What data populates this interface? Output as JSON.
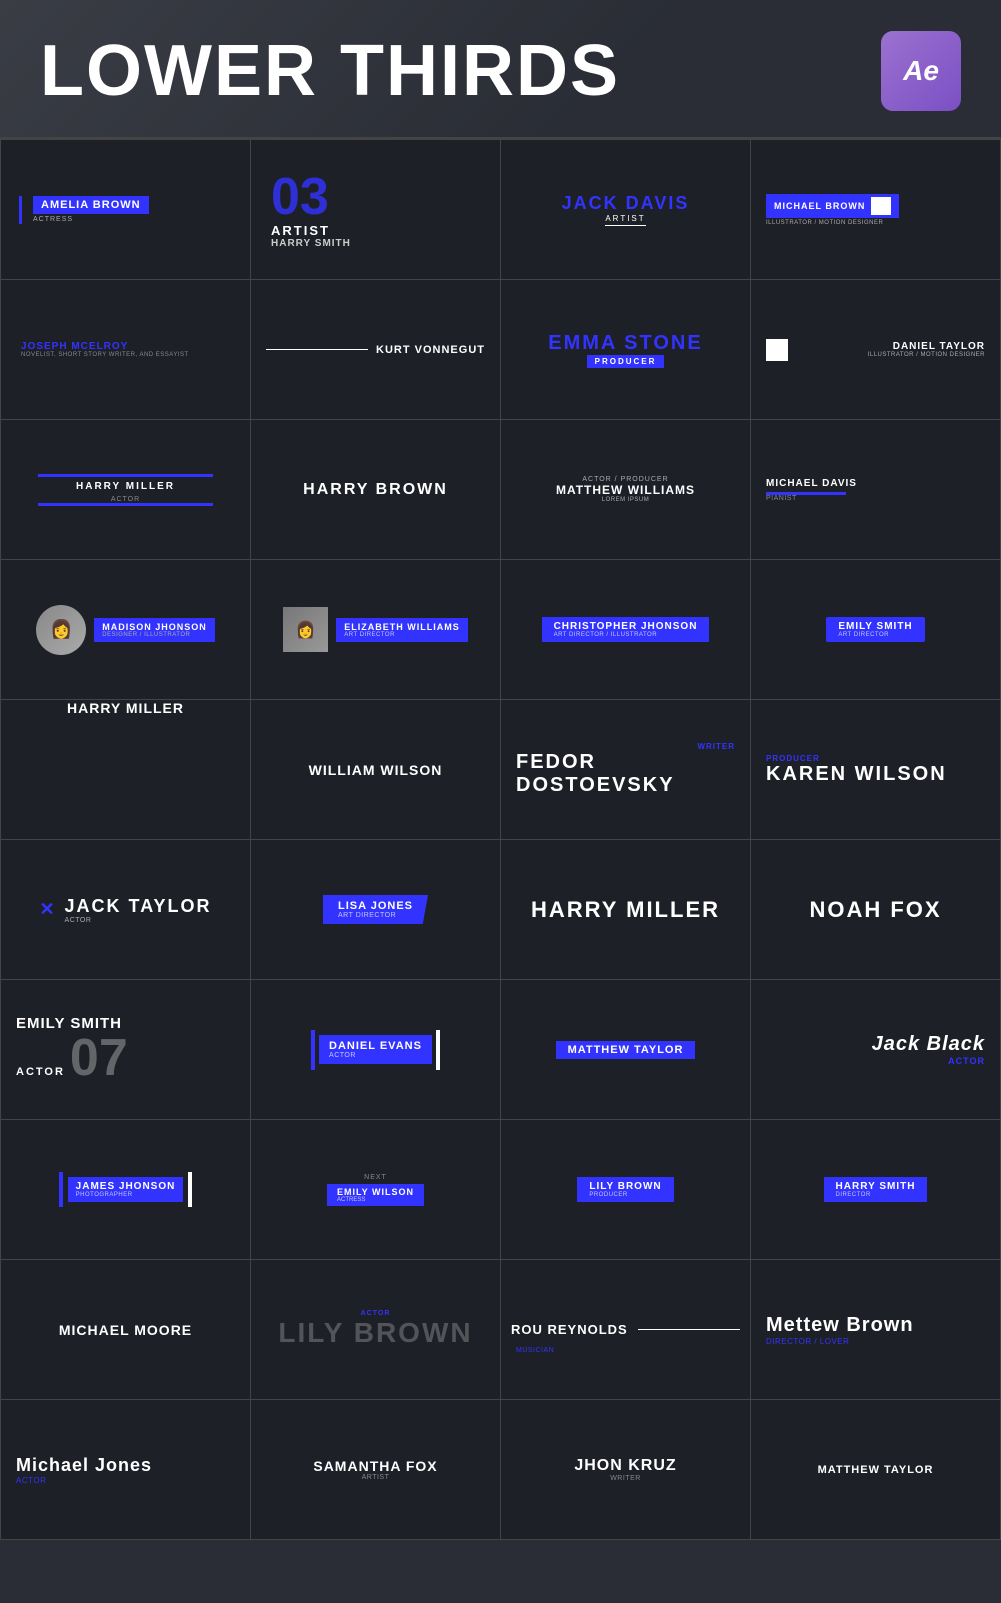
{
  "header": {
    "title": "LOWER THIRDS",
    "ae_label": "Ae"
  },
  "grid": {
    "rows": [
      [
        {
          "name": "AMELIA BROWN",
          "role": "ACTRESS",
          "style": "blue-bar-left"
        },
        {
          "number": "03",
          "title": "ARTIST",
          "subtitle": "HARRY SMITH",
          "style": "number-title"
        },
        {
          "name": "JACK DAVIS",
          "role": "ARTIST",
          "style": "centered-blue-underline"
        },
        {
          "name": "MICHAEL BROWN",
          "role": "ILLUSTRATOR / MOTION DESIGNER",
          "style": "blue-bar-white-square"
        }
      ],
      [
        {
          "name": "JOSEPH MCELROY",
          "role": "NOVELIST, SHORT STORY WRITER, AND ESSAYIST",
          "style": "blue-text-small"
        },
        {
          "name": "KURT VONNEGUT",
          "role": "",
          "style": "line-left-name"
        },
        {
          "name": "EMMA STONE",
          "role": "PRODUCER",
          "style": "big-blue-name-blue-badge"
        },
        {
          "name": "DANIEL TAYLOR",
          "role": "ILLUSTRATOR / MOTION DESIGNER",
          "style": "white-sq-left-name-right"
        }
      ],
      [
        {
          "name": "HARRY MILLER",
          "role": "ACTOR",
          "style": "bar-above-below"
        },
        {
          "name": "HARRY BROWN",
          "role": "",
          "style": "plain-center"
        },
        {
          "name": "MATTHEW WILLIAMS",
          "role": "ACTOR / PRODUCER",
          "role2": "LOREM IPSUM",
          "style": "role-above-name"
        },
        {
          "name": "MICHAEL DAVIS",
          "role": "PIANIST",
          "style": "name-left-blue-bar"
        }
      ],
      [
        {
          "name": "MADISON JHONSON",
          "role": "DESIGNER / ILLUSTRATOR",
          "style": "avatar-circle-blue",
          "avatar": "👩"
        },
        {
          "name": "ELIZABETH WILLIAMS",
          "role": "ART DIRECTOR",
          "style": "avatar-sq-blue",
          "avatar": "👩"
        },
        {
          "name": "CHRISTOPHER JHONSON",
          "role": "ART DIRECTOR / ILLUSTRATOR",
          "style": "full-blue-bar"
        },
        {
          "name": "EMILY SMITH",
          "role": "ART DIRECTOR",
          "style": "full-blue-bar-rounded"
        }
      ],
      [
        {
          "name": "HARRY MILLER",
          "role": "",
          "style": "plain-left"
        },
        {
          "name": "WILLIAM WILSON",
          "role": "",
          "style": "plain-center"
        },
        {
          "name": "FEDOR DOSTOEVSKY",
          "role": "WRITER",
          "style": "role-above-big-right"
        },
        {
          "name": "KAREN WILSON",
          "role": "PRODUCER",
          "style": "role-above-big-left"
        }
      ],
      [
        {
          "name": "JACK TAYLOR",
          "role": "ACTOR",
          "style": "x-icon-name"
        },
        {
          "name": "LISA JONES",
          "role": "ART DIRECTOR",
          "style": "parallelogram-blue"
        },
        {
          "name": "HARRY MILLER",
          "role": "",
          "style": "big-plain-center"
        },
        {
          "name": "NOAH FOX",
          "role": "",
          "style": "big-plain-center"
        }
      ],
      [
        {
          "name": "EMILY SMITH",
          "role": "ACTOR",
          "number": "07",
          "style": "name-actor-number"
        },
        {
          "name": "DANIEL EVANS",
          "role": "ACTOR",
          "style": "bar-blue-bar-white"
        },
        {
          "name": "MATTHEW TAYLOR",
          "role": "",
          "style": "blue-bg-name"
        },
        {
          "name": "Jack Black",
          "role": "Actor",
          "style": "italic-name-blue-role"
        }
      ],
      [
        {
          "name": "JAMES JHONSON",
          "role": "PHOTOGRAPHER",
          "style": "bar-blue-name-bar-white"
        },
        {
          "name": "EMILY WILSON",
          "role": "ACTRESS",
          "label": "NEXT",
          "style": "next-label-blue"
        },
        {
          "name": "LILY BROWN",
          "role": "PRODUCER",
          "style": "blue-bg-name"
        },
        {
          "name": "HARRY SMITH",
          "role": "DIRECTOR",
          "style": "blue-bg-name"
        }
      ],
      [
        {
          "name": "MICHAEL MOORE",
          "role": "",
          "style": "plain-center"
        },
        {
          "name": "LILY BROWN",
          "role": "ACTOR",
          "style": "role-big-faded-name"
        },
        {
          "name": "ROU REYNOLDS",
          "role": "MUSICIAN",
          "style": "name-line-right"
        },
        {
          "name": "Mettew Brown",
          "role": "DIRECTOR / LOVER",
          "style": "serif-name-blue-role"
        }
      ],
      [
        {
          "name": "Michael Jones",
          "role": "Actor",
          "style": "serif-name-blue-role-left"
        },
        {
          "name": "SAMANTHA FOX",
          "role": "ARTIST",
          "style": "plain-center-role"
        },
        {
          "name": "JHON KRUZ",
          "role": "WRITER",
          "style": "plain-center-role"
        },
        {
          "name": "MATTHEW TAYLOR",
          "role": "",
          "style": "plain-center-small"
        }
      ]
    ]
  }
}
